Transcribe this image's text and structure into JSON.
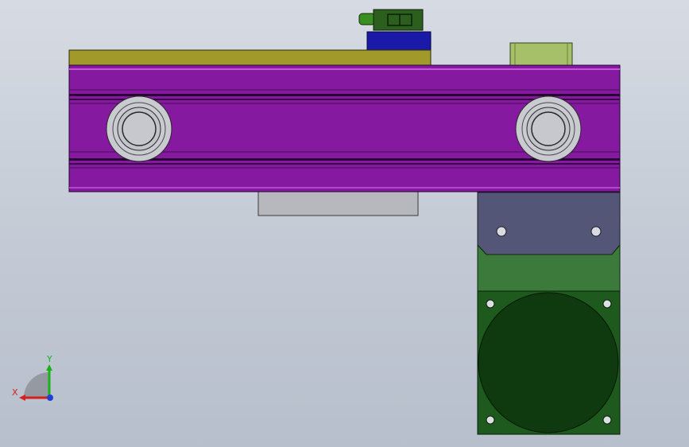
{
  "viewport": {
    "background_top": "#d6dbe3",
    "background_bottom": "#b7bfcc"
  },
  "model": {
    "components": [
      {
        "name": "linear-rail-housing",
        "color": "#8519a0"
      },
      {
        "name": "top-mounting-plate",
        "color": "#a19a2a"
      },
      {
        "name": "carriage-block",
        "color": "#1b1aa8"
      },
      {
        "name": "sensor-connector",
        "color": "#2e6b1e"
      },
      {
        "name": "end-cap-block",
        "color": "#a6c06a"
      },
      {
        "name": "lower-gray-plate",
        "color": "#b6b8bd"
      },
      {
        "name": "motor-adapter-plate",
        "color": "#545677"
      },
      {
        "name": "motor-flange",
        "color": "#3c7a3c"
      },
      {
        "name": "motor-body",
        "color": "#1e5a1e"
      },
      {
        "name": "left-pulley",
        "color": "#c9cbd0"
      },
      {
        "name": "right-pulley",
        "color": "#c9cbd0"
      }
    ]
  },
  "triad": {
    "x_label": "X",
    "y_label": "Y",
    "x_color": "#d62020",
    "y_color": "#19b319",
    "z_color": "#1f3fd6"
  }
}
